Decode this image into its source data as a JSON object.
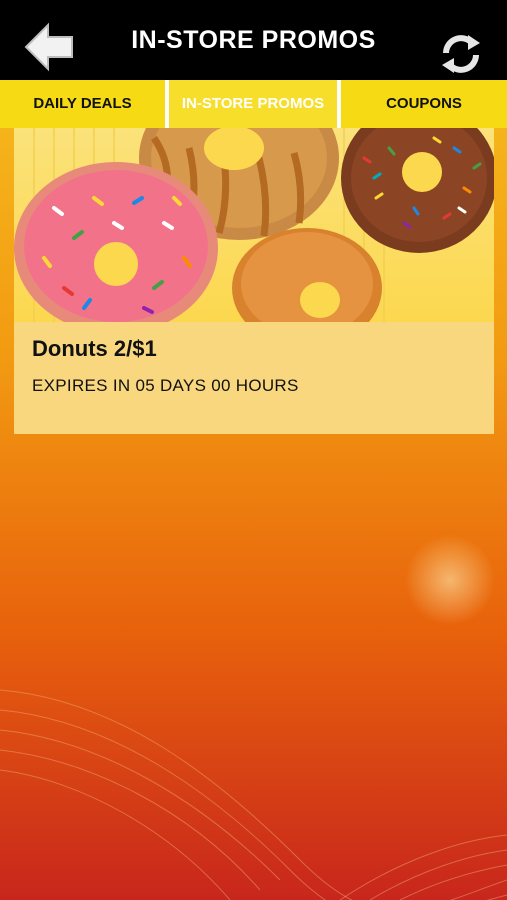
{
  "header": {
    "title": "IN-STORE PROMOS",
    "back_icon": "arrow-left-icon",
    "refresh_icon": "refresh-icon"
  },
  "tabs": [
    {
      "label": "DAILY DEALS",
      "active": false
    },
    {
      "label": "IN-STORE PROMOS",
      "active": true
    },
    {
      "label": "COUPONS",
      "active": false
    }
  ],
  "promos": [
    {
      "title": "Donuts 2/$1",
      "expiry": "EXPIRES IN 05 DAYS 00 HOURS",
      "image": "donuts-image"
    }
  ],
  "colors": {
    "header_bg": "#000000",
    "tab_bg": "#f5da14",
    "active_tab_text": "#ffffff",
    "card_bg": "#f8d77f"
  }
}
